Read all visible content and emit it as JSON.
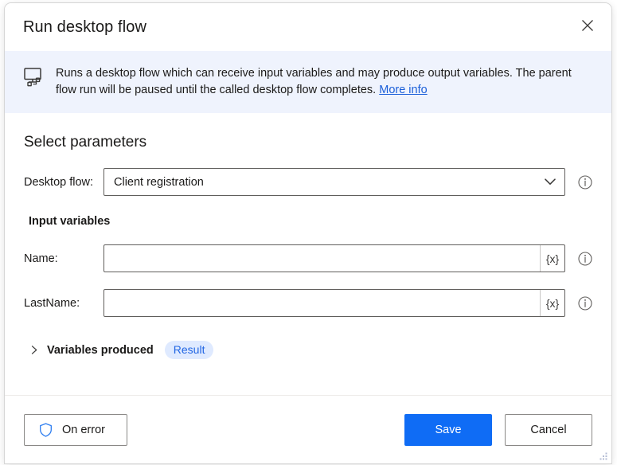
{
  "dialog": {
    "title": "Run desktop flow",
    "close_icon": "close-icon"
  },
  "banner": {
    "icon": "desktop-flow-icon",
    "text": "Runs a desktop flow which can receive input variables and may produce output variables. The parent flow run will be paused until the called desktop flow completes. ",
    "link_label": "More info"
  },
  "main": {
    "section_title": "Select parameters",
    "desktop_flow": {
      "label": "Desktop flow:",
      "value": "Client registration",
      "arrow_icon": "chevron-down-icon",
      "info_icon": "info-icon"
    },
    "input_variables_heading": "Input variables",
    "inputs": [
      {
        "label": "Name:",
        "value": "",
        "placeholder": "",
        "var_button": "{x}",
        "info_icon": "info-icon"
      },
      {
        "label": "LastName:",
        "value": "",
        "placeholder": "",
        "var_button": "{x}",
        "info_icon": "info-icon"
      }
    ],
    "variables_produced": {
      "expand_icon": "chevron-right-icon",
      "label": "Variables produced",
      "chip": "Result"
    }
  },
  "footer": {
    "on_error_label": "On error",
    "on_error_icon": "shield-icon",
    "save_label": "Save",
    "cancel_label": "Cancel",
    "resize_grip": "resize-grip-icon"
  },
  "colors": {
    "accent": "#0f6cf5",
    "banner_bg": "#eff3fd",
    "link": "#1b5fd9",
    "chip_bg": "#dfeaff",
    "chip_text": "#2266e3",
    "shield": "#2b7cf0",
    "border": "#605e5c",
    "text": "#1b1a19"
  }
}
